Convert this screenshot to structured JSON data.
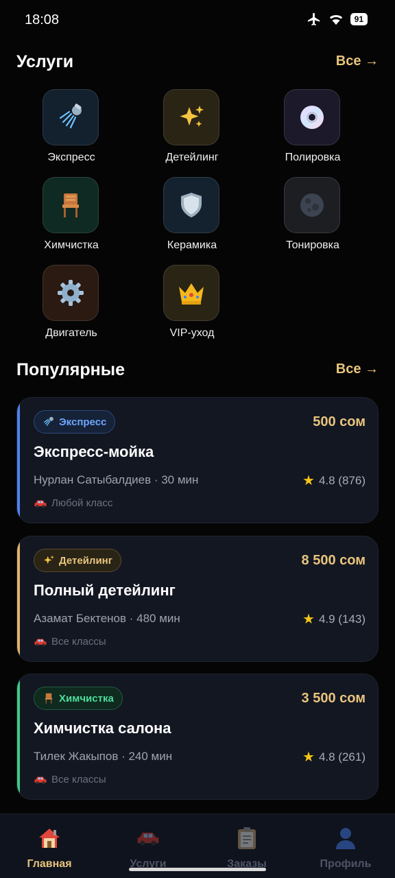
{
  "status_bar": {
    "time": "18:08",
    "battery": "91"
  },
  "services_section": {
    "title": "Услуги",
    "all_label": "Все →",
    "items": [
      {
        "label": "Экспресс",
        "icon": "shower-icon",
        "bg": "#13202e"
      },
      {
        "label": "Детейлинг",
        "icon": "sparkles-icon",
        "bg": "#2a2414"
      },
      {
        "label": "Полировка",
        "icon": "disc-icon",
        "bg": "#1c1a2a"
      },
      {
        "label": "Химчистка",
        "icon": "chair-icon",
        "bg": "#0f2a22"
      },
      {
        "label": "Керамика",
        "icon": "shield-icon",
        "bg": "#13222e"
      },
      {
        "label": "Тонировка",
        "icon": "moon-icon",
        "bg": "#1c1e22"
      },
      {
        "label": "Двигатель",
        "icon": "gear-icon",
        "bg": "#2a1a12"
      },
      {
        "label": "VIP-уход",
        "icon": "crown-icon",
        "bg": "#2a2414"
      }
    ]
  },
  "popular_section": {
    "title": "Популярные",
    "all_label": "Все →",
    "cards": [
      {
        "tag": "Экспресс",
        "tag_icon": "shower-icon",
        "tag_color": "#6fa6ff",
        "tag_bg": "#152238",
        "accent": "#4f83f0",
        "price": "500 сом",
        "name": "Экспресс-мойка",
        "meta": "Нурлан Сатыбалдиев · 30 мин",
        "rating": "4.8 (876)",
        "car_class": "Любой класс"
      },
      {
        "tag": "Детейлинг",
        "tag_icon": "sparkles-icon",
        "tag_color": "#e9c47d",
        "tag_bg": "#2a2416",
        "accent": "#e0b467",
        "price": "8 500 сом",
        "name": "Полный детейлинг",
        "meta": "Азамат Бектенов · 480 мин",
        "rating": "4.9 (143)",
        "car_class": "Все классы"
      },
      {
        "tag": "Химчистка",
        "tag_icon": "chair-icon",
        "tag_color": "#4ddc9a",
        "tag_bg": "#0f2a1f",
        "accent": "#3dcb83",
        "price": "3 500 сом",
        "name": "Химчистка салона",
        "meta": "Тилек Жакыпов · 240 мин",
        "rating": "4.8 (261)",
        "car_class": "Все классы"
      }
    ]
  },
  "bottom_nav": {
    "items": [
      {
        "label": "Главная",
        "icon": "home-icon",
        "active": true
      },
      {
        "label": "Услуги",
        "icon": "car-icon",
        "active": false
      },
      {
        "label": "Заказы",
        "icon": "clipboard-icon",
        "active": false
      },
      {
        "label": "Профиль",
        "icon": "user-icon",
        "active": false
      }
    ]
  }
}
